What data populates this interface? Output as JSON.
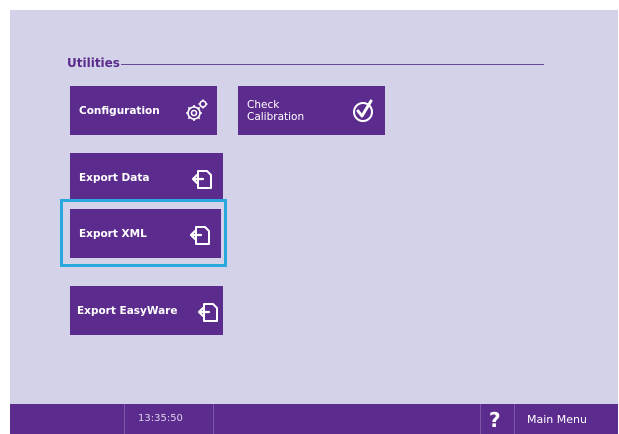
{
  "section": {
    "title": "Utilities"
  },
  "tiles": {
    "configuration": {
      "label": "Configuration",
      "icon": "gear-icon"
    },
    "check_calibration": {
      "label": "Check\nCalibration",
      "icon": "checkmark-circle-icon"
    },
    "export_data": {
      "label": "Export Data",
      "icon": "export-icon"
    },
    "export_xml": {
      "label": "Export XML",
      "icon": "export-icon"
    },
    "export_easyware": {
      "label": "Export EasyWare",
      "icon": "export-icon"
    }
  },
  "statusbar": {
    "time": "13:35:50",
    "help_label": "?",
    "main_menu_label": "Main Menu"
  },
  "colors": {
    "background": "#d3d2e8",
    "tile": "#5c2b8e",
    "selection": "#28a8dc"
  }
}
